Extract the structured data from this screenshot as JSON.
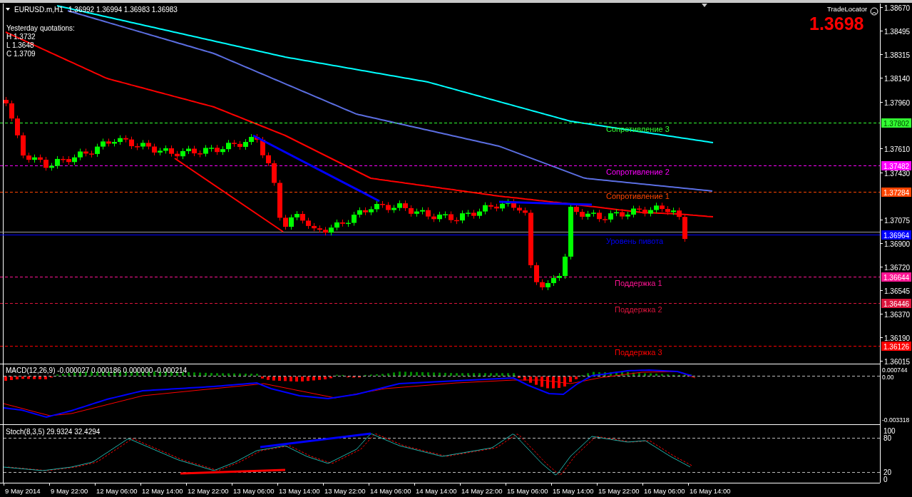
{
  "header": {
    "symbol": "EURUSD.m,H1",
    "ohlc": "1.36992 1.36994 1.36983 1.36983"
  },
  "yesterday": {
    "title": "Yesterday quotations:",
    "lines": [
      "H 1.3732",
      "L 1.3648",
      "C 1.3709"
    ]
  },
  "trade_locator": {
    "label": "TradeLocator",
    "price": "1.3698"
  },
  "price_axis": [
    "1.38670",
    "1.38495",
    "1.38315",
    "1.38140",
    "1.37960",
    "1.37610",
    "1.37430",
    "1.37075",
    "1.36900",
    "1.36720",
    "1.36545",
    "1.36370",
    "1.36190",
    "1.36015"
  ],
  "levels": [
    {
      "label": "Сопротивление 3",
      "price_tag": "1.37802",
      "color": "#33ff33"
    },
    {
      "label": "Сопротивление 2",
      "price_tag": "1.37482",
      "color": "#ff00ff"
    },
    {
      "label": "Сопротивление 1",
      "price_tag": "1.37284",
      "color": "#ff4500"
    },
    {
      "label": "Уровень пивота",
      "price_tag": "1.36964",
      "color": "#0000ff"
    },
    {
      "label": "Поддержка 1",
      "price_tag": "1.36644",
      "color": "#ff1493"
    },
    {
      "label": "Поддержка 2",
      "price_tag": "1.36446",
      "color": "#dc143c"
    },
    {
      "label": "Поддержка 3",
      "price_tag": "1.36126",
      "color": "#ff0000"
    }
  ],
  "macd": {
    "label": "MACD(12,26,9) -0.000027 0.000186 0.000000 -0.000214",
    "axis": [
      "0.000744",
      "0.00",
      "-0.003318"
    ]
  },
  "stoch": {
    "label": "Stoch(8,3,5) 29.9324 32.4294",
    "axis": [
      "100",
      "80",
      "20",
      "0"
    ]
  },
  "time_axis": [
    "9 May 2014",
    "9 May 22:00",
    "12 May 06:00",
    "12 May 14:00",
    "12 May 22:00",
    "13 May 06:00",
    "13 May 14:00",
    "13 May 22:00",
    "14 May 06:00",
    "14 May 14:00",
    "14 May 22:00",
    "15 May 06:00",
    "15 May 14:00",
    "15 May 22:00",
    "16 May 06:00",
    "16 May 14:00"
  ]
}
